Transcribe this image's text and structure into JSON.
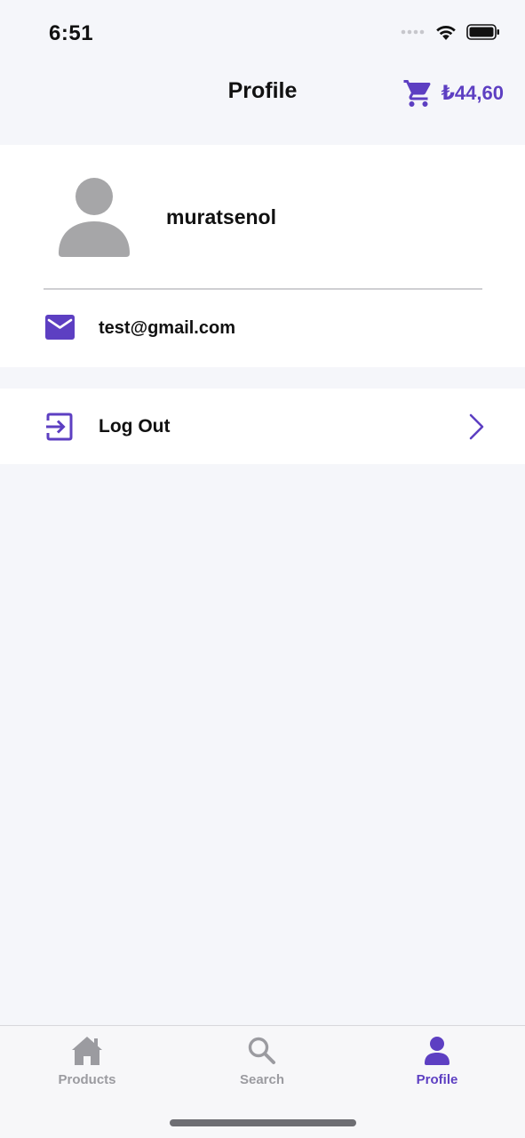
{
  "status_bar": {
    "time": "6:51"
  },
  "header": {
    "title": "Profile",
    "cart_total": "₺44,60"
  },
  "profile": {
    "username": "muratsenol",
    "email": "test@gmail.com"
  },
  "actions": {
    "logout_label": "Log Out"
  },
  "tab_bar": {
    "tabs": [
      {
        "label": "Products",
        "icon": "house-icon"
      },
      {
        "label": "Search",
        "icon": "magnifier-icon"
      },
      {
        "label": "Profile",
        "icon": "person-icon",
        "active": true
      }
    ]
  },
  "colors": {
    "accent": "#5d3fc2",
    "inactive": "#9b9ba0",
    "background": "#f5f6fa"
  }
}
